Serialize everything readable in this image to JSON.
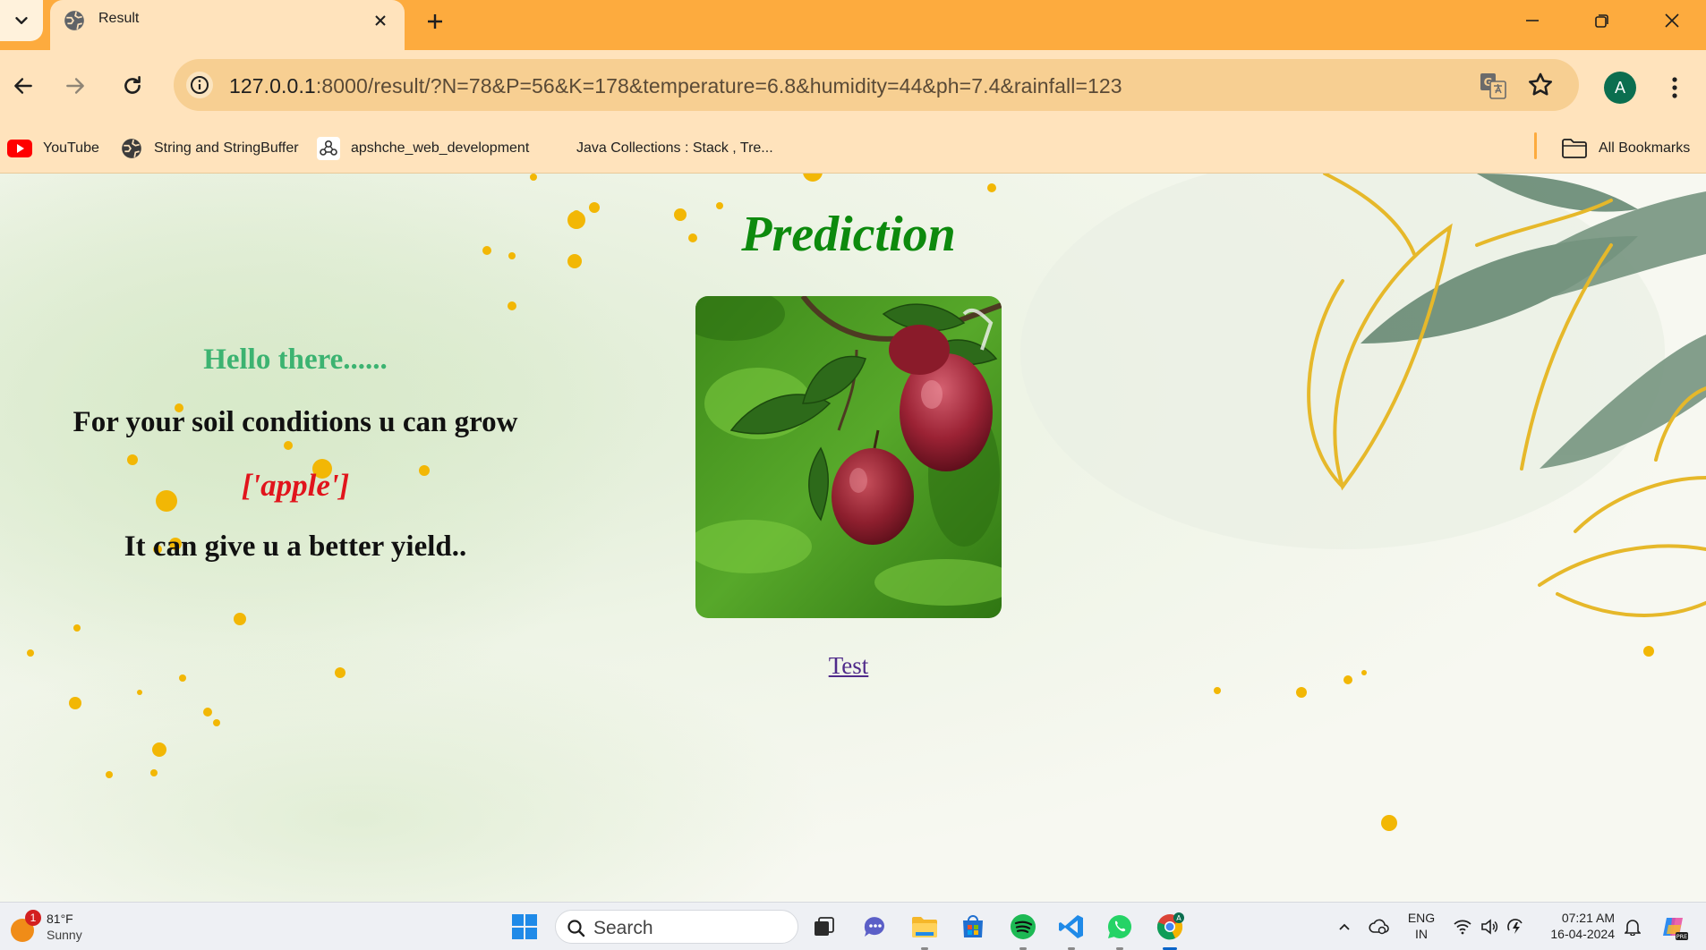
{
  "browser": {
    "tab": {
      "title": "Result"
    },
    "address_bar": {
      "url_host": "127.0.0.1",
      "url_path": ":8000/result/?N=78&P=56&K=178&temperature=6.8&humidity=44&ph=7.4&rainfall=123"
    },
    "profile_initial": "A",
    "bookmarks": [
      {
        "label": "YouTube",
        "icon": "youtube-icon"
      },
      {
        "label": "String and StringBuffer",
        "icon": "globe-icon"
      },
      {
        "label": "apshche_web_development",
        "icon": "github-icon"
      },
      {
        "label": "Java Collections : Stack , Tre...",
        "icon": "none"
      }
    ],
    "all_bookmarks_label": "All Bookmarks"
  },
  "page": {
    "title": "Prediction",
    "greeting": "Hello there......",
    "line1": "For your soil conditions u can grow",
    "crop": "['apple']",
    "line2": "It can give u a better yield..",
    "link_label": "Test",
    "image_subject": "apples-on-tree"
  },
  "colors": {
    "tabstrip": "#fdab3e",
    "toolbar": "#ffe3bc",
    "title_green": "#0d8a0d",
    "greeting_green": "#3cb371",
    "crop_red": "#e1141c",
    "link_purple": "#4f2a8a"
  },
  "taskbar": {
    "weather": {
      "temp": "81°F",
      "condition": "Sunny",
      "badge": "1"
    },
    "search_placeholder": "Search",
    "pinned_apps": [
      "task-view",
      "chat",
      "file-explorer",
      "microsoft-store",
      "spotify",
      "vscode",
      "whatsapp",
      "chrome"
    ],
    "language": {
      "line1": "ENG",
      "line2": "IN"
    },
    "clock": {
      "time": "07:21 AM",
      "date": "16-04-2024"
    }
  }
}
